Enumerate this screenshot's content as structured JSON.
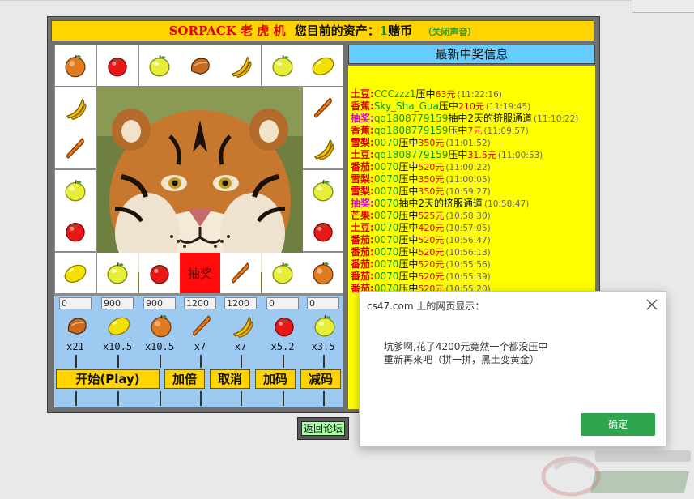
{
  "header": {
    "brand": "SORPACK",
    "game_name": "老 虎 机",
    "assets_label": "您目前的资产：",
    "assets_value": "1",
    "assets_unit": "赌币",
    "mute_label": "（关闭声音）"
  },
  "board": {
    "cells": [
      {
        "icon": "orange"
      },
      {
        "icon": "tomato"
      },
      {
        "icon": "apple"
      },
      {
        "icon": "bread"
      },
      {
        "icon": "banana"
      },
      {
        "icon": "apple"
      },
      {
        "icon": "lemon"
      },
      {
        "icon": "banana"
      },
      {
        "icon": "carrot"
      },
      {
        "icon": "carrot"
      },
      {
        "icon": "banana"
      },
      {
        "icon": "apple"
      },
      {
        "icon": "apple"
      },
      {
        "icon": "tomato"
      },
      {
        "icon": "tomato"
      },
      {
        "icon": "lemon"
      },
      {
        "icon": "apple"
      },
      {
        "icon": "tomato"
      },
      {
        "icon": "lottery",
        "label": "抽奖"
      },
      {
        "icon": "carrot"
      },
      {
        "icon": "apple"
      },
      {
        "icon": "orange"
      }
    ]
  },
  "bets": [
    {
      "value": "0",
      "icon": "bread",
      "multiplier": "x21"
    },
    {
      "value": "900",
      "icon": "lemon",
      "multiplier": "x10.5"
    },
    {
      "value": "900",
      "icon": "orange",
      "multiplier": "x10.5"
    },
    {
      "value": "1200",
      "icon": "carrot",
      "multiplier": "x7"
    },
    {
      "value": "1200",
      "icon": "banana",
      "multiplier": "x7"
    },
    {
      "value": "0",
      "icon": "tomato",
      "multiplier": "x5.2"
    },
    {
      "value": "0",
      "icon": "apple",
      "multiplier": "x3.5"
    }
  ],
  "controls": {
    "start": "开始(Play)",
    "double": "加倍",
    "cancel": "取消",
    "add": "加码",
    "reduce": "减码"
  },
  "news": {
    "title": "最新中奖信息",
    "rows": [
      {
        "kind": "土豆:",
        "user": "CCCzzz1",
        "act": "压中",
        "amt": "63元",
        "time": "(11:22:16)"
      },
      {
        "kind": "香蕉:",
        "user": "Sky_Sha_Gua",
        "act": "压中",
        "amt": "210元",
        "time": "(11:19:45)"
      },
      {
        "kind": "抽奖:",
        "user": "qq1808779159",
        "act": "抽中2天的挤服通道",
        "amt": "",
        "time": "(11:10:22)",
        "special": true
      },
      {
        "kind": "香蕉:",
        "user": "qq1808779159",
        "act": "压中",
        "amt": "7元",
        "time": "(11:09:57)"
      },
      {
        "kind": "雪梨:",
        "user": "0070",
        "act": "压中",
        "amt": "350元",
        "time": "(11:01:52)"
      },
      {
        "kind": "土豆:",
        "user": "qq1808779159",
        "act": "压中",
        "amt": "31.5元",
        "time": "(11:00:53)"
      },
      {
        "kind": "番茄:",
        "user": "0070",
        "act": "压中",
        "amt": "520元",
        "time": "(11:00:22)"
      },
      {
        "kind": "雪梨:",
        "user": "0070",
        "act": "压中",
        "amt": "350元",
        "time": "(11:00:05)"
      },
      {
        "kind": "雪梨:",
        "user": "0070",
        "act": "压中",
        "amt": "350元",
        "time": "(10:59:27)"
      },
      {
        "kind": "抽奖:",
        "user": "0070",
        "act": "抽中2天的挤服通道",
        "amt": "",
        "time": "(10:58:47)",
        "special": true
      },
      {
        "kind": "芒果:",
        "user": "0070",
        "act": "压中",
        "amt": "525元",
        "time": "(10:58:30)"
      },
      {
        "kind": "土豆:",
        "user": "0070",
        "act": "压中",
        "amt": "420元",
        "time": "(10:57:05)"
      },
      {
        "kind": "番茄:",
        "user": "0070",
        "act": "压中",
        "amt": "520元",
        "time": "(10:56:47)"
      },
      {
        "kind": "番茄:",
        "user": "0070",
        "act": "压中",
        "amt": "520元",
        "time": "(10:56:13)"
      },
      {
        "kind": "番茄:",
        "user": "0070",
        "act": "压中",
        "amt": "520元",
        "time": "(10:55:56)"
      },
      {
        "kind": "番茄:",
        "user": "0070",
        "act": "压中",
        "amt": "520元",
        "time": "(10:55:39)"
      },
      {
        "kind": "番茄:",
        "user": "0070",
        "act": "压中",
        "amt": "520元",
        "time": "(10:55:20)"
      }
    ]
  },
  "back_link": "返回论坛",
  "dialog": {
    "title": "cs47.com 上的网页显示：",
    "line1": "坑爹啊,花了4200元竟然一个都没压中",
    "line2": "重新再来吧（拼一拼，黑土变黄金）",
    "ok": "确定"
  },
  "colors": {
    "title_bar": "#ffd400",
    "news_bg": "#ffff00",
    "news_head": "#66ccff",
    "bet_panel": "#9ec9f0",
    "lottery_cell": "#ff0d0d",
    "ok_button": "#2fa54e"
  }
}
